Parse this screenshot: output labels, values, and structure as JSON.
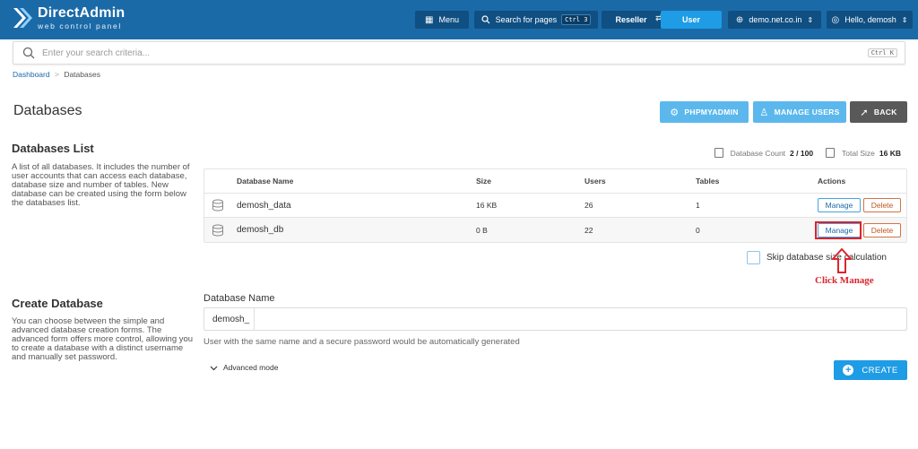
{
  "header": {
    "logo_title": "DirectAdmin",
    "logo_subtitle": "web control panel",
    "menu_label": "Menu",
    "search_pages_label": "Search for pages",
    "search_pages_shortcut": "Ctrl 3",
    "role_reseller": "Reseller",
    "role_user": "User",
    "domain": "demo.net.co.in",
    "greeting": "Hello, demosh",
    "brand_color": "#1b6aa8"
  },
  "search": {
    "placeholder": "Enter your search criteria...",
    "shortcut": "Ctrl K"
  },
  "breadcrumb": {
    "home": "Dashboard",
    "separator": ">",
    "current": "Databases"
  },
  "page": {
    "title": "Databases",
    "phpmyadmin_label": "PHPMYADMIN",
    "manage_users_label": "MANAGE USERS",
    "back_label": "BACK"
  },
  "db_list": {
    "title": "Databases List",
    "description": "A list of all databases. It includes the number of user accounts that can access each database, database size and number of tables. New database can be created using the form below the databases list.",
    "count_label": "Database Count",
    "count_value": "2 / 100",
    "size_label": "Total Size",
    "size_value": "16 KB",
    "columns": [
      "Database Name",
      "Size",
      "Users",
      "Tables",
      "Actions"
    ],
    "rows": [
      {
        "name": "demosh_data",
        "size": "16 KB",
        "users": "26",
        "tables": "1"
      },
      {
        "name": "demosh_db",
        "size": "0 B",
        "users": "22",
        "tables": "0"
      }
    ],
    "manage_label": "Manage",
    "delete_label": "Delete",
    "skip_label": "Skip database size calculation"
  },
  "annotation": {
    "text": "Click Manage",
    "color": "#d9262e"
  },
  "create": {
    "title": "Create Database",
    "description": "You can choose between the simple and advanced database creation forms. The advanced form offers more control, allowing you to create a database with a distinct username and manually set password.",
    "field_label": "Database Name",
    "prefix": "demosh_",
    "value": "",
    "hint": "User with the same name and a secure password would be automatically generated",
    "advanced_label": "Advanced mode",
    "create_label": "CREATE"
  }
}
